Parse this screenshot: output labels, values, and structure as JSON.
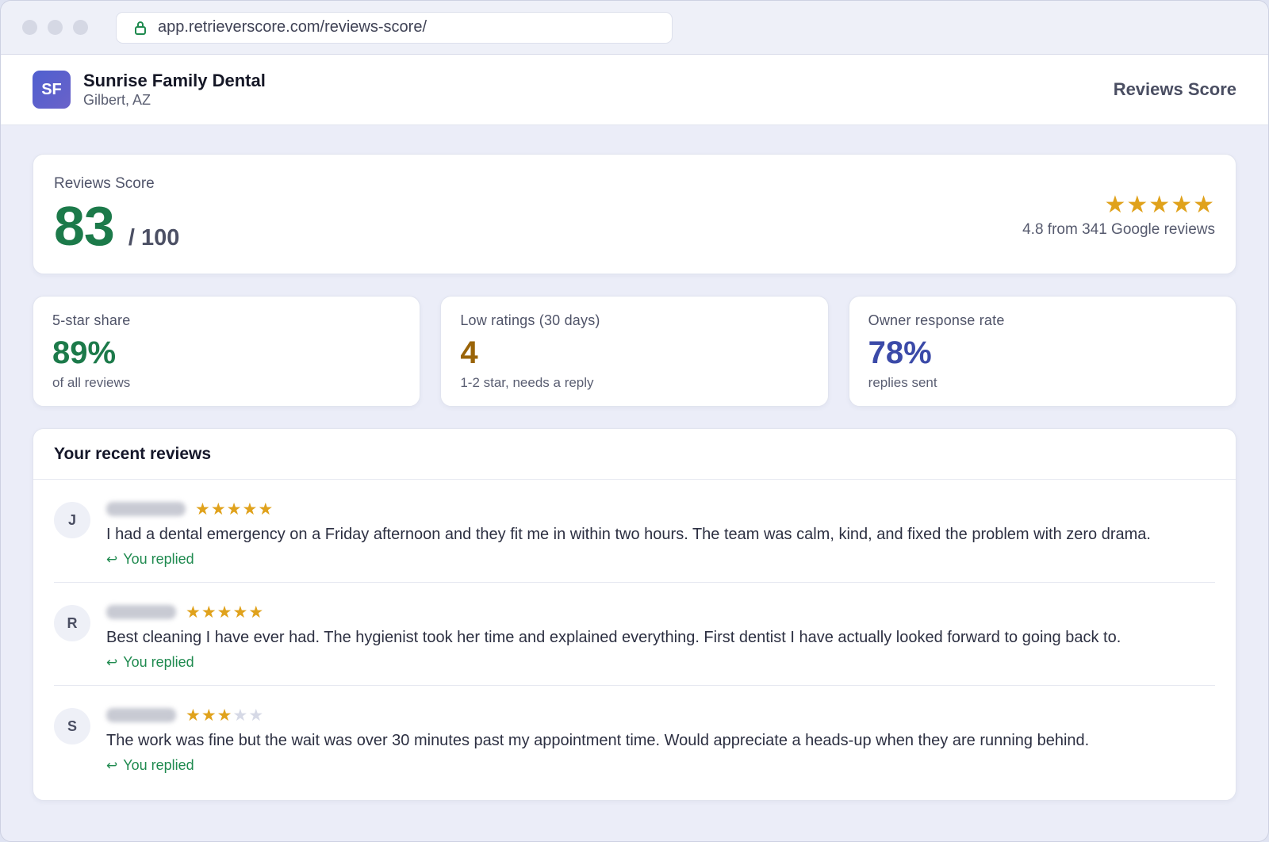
{
  "browser": {
    "url": "app.retrieverscore.com/reviews-score/"
  },
  "header": {
    "logo_initials": "SF",
    "business_name": "Sunrise Family Dental",
    "location": "Gilbert, AZ",
    "app_title": "Reviews Score"
  },
  "score": {
    "label": "Reviews Score",
    "value": "83",
    "max": "/ 100",
    "stars": "★★★★★",
    "google_summary": "4.8 from 341 Google reviews"
  },
  "stats": [
    {
      "label": "5-star share",
      "value": "89%",
      "sub": "of all reviews",
      "color": "#1c7a4a"
    },
    {
      "label": "Low ratings (30 days)",
      "value": "4",
      "sub": "1-2 star, needs a reply",
      "color": "#9a6408"
    },
    {
      "label": "Owner response rate",
      "value": "78%",
      "sub": "replies sent",
      "color": "#3b4aa8"
    }
  ],
  "reviews": {
    "title": "Your recent reviews",
    "items": [
      {
        "initial": "J",
        "rating": 5,
        "text": "I had a dental emergency on a Friday afternoon and they fit me in within two hours. The team was calm, kind, and fixed the problem with zero drama.",
        "reply_status": "You replied"
      },
      {
        "initial": "R",
        "rating": 5,
        "text": "Best cleaning I have ever had. The hygienist took her time and explained everything. First dentist I have actually looked forward to going back to.",
        "reply_status": "You replied"
      },
      {
        "initial": "S",
        "rating": 3,
        "text": "The work was fine but the wait was over 30 minutes past my appointment time. Would appreciate a heads-up when they are running behind.",
        "reply_status": "You replied"
      }
    ]
  },
  "colors": {
    "star": "#e0a21c",
    "star_off": "#d6d9e6",
    "replied": "#1f8a4f"
  },
  "icons": {
    "lock": "lock-icon",
    "reply": "reply-arrow-icon"
  }
}
